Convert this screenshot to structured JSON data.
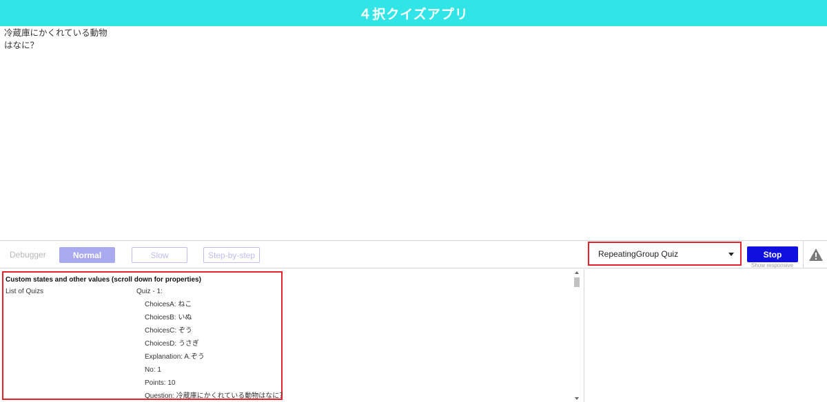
{
  "header": {
    "title": "４択クイズアプリ"
  },
  "question": {
    "line1": "冷蔵庫にかくれている動物",
    "line2": "はなに？"
  },
  "debugger": {
    "label": "Debugger",
    "normal_label": "Normal",
    "slow_label": "Slow",
    "step_label": "Step-by-step",
    "inspect_value": "RepeatingGroup Quiz",
    "stop_label": "Stop",
    "show_responsive": "Show responsive",
    "warning_icon": "warning-triangle-icon"
  },
  "state_panel": {
    "title": "Custom states and other values (scroll down for properties)",
    "label": "List of Quizs",
    "value_header": "Quiz - 1:",
    "fields": [
      "ChoicesA: ねこ",
      "ChoicesB: いぬ",
      "ChoicesC: ぞう",
      "ChoicesD: うさぎ",
      "Explanation: A.ぞう",
      "No: 1",
      "Points: 10",
      "Question: 冷蔵庫にかくれている動物はなに？"
    ]
  },
  "colors": {
    "header_bg": "#31e5e6",
    "highlight": "#e5202a",
    "primary_button": "#0f0fe0",
    "normal_button": "#a9a9ef"
  }
}
